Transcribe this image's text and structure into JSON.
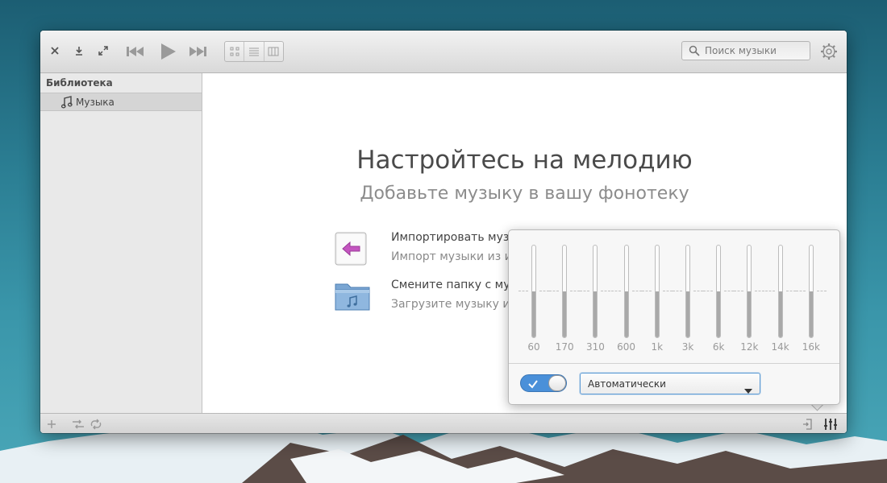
{
  "titlebar": {
    "close_icon": "close-icon",
    "download_icon": "download-icon",
    "fullscreen_icon": "fullscreen-icon",
    "prev_icon": "previous-track-icon",
    "play_icon": "play-icon",
    "next_icon": "next-track-icon",
    "view_modes": [
      "grid-view-icon",
      "list-view-icon",
      "column-view-icon"
    ],
    "search_placeholder": "Поиск музыки",
    "settings_icon": "gear-icon"
  },
  "sidebar": {
    "header": "Библиотека",
    "items": [
      {
        "label": "Музыка",
        "icon": "music-note-icon",
        "selected": true
      }
    ]
  },
  "welcome": {
    "title": "Настройтесь на мелодию",
    "subtitle": "Добавьте музыку в вашу фонотеку",
    "actions": [
      {
        "title": "Импортировать музы",
        "description": "Импорт музыки из и",
        "icon": "import-icon"
      },
      {
        "title": "Смените папку с муз",
        "description": "Загрузите музыку из",
        "icon": "music-folder-icon"
      }
    ]
  },
  "statusbar": {
    "add_icon": "add-icon",
    "shuffle_icon": "shuffle-icon",
    "repeat_icon": "repeat-icon",
    "info_icon": "info-panel-icon",
    "equalizer_icon": "equalizer-icon"
  },
  "equalizer": {
    "bands": [
      {
        "freq": "60",
        "level": 0
      },
      {
        "freq": "170",
        "level": 0
      },
      {
        "freq": "310",
        "level": 0
      },
      {
        "freq": "600",
        "level": 0
      },
      {
        "freq": "1k",
        "level": 0
      },
      {
        "freq": "3k",
        "level": 0
      },
      {
        "freq": "6k",
        "level": 0
      },
      {
        "freq": "12k",
        "level": 0
      },
      {
        "freq": "14k",
        "level": 0
      },
      {
        "freq": "16k",
        "level": 0
      }
    ],
    "enabled": true,
    "preset": "Автоматически"
  },
  "colors": {
    "accent": "#4a90d9",
    "import_arrow": "#c455c0"
  }
}
